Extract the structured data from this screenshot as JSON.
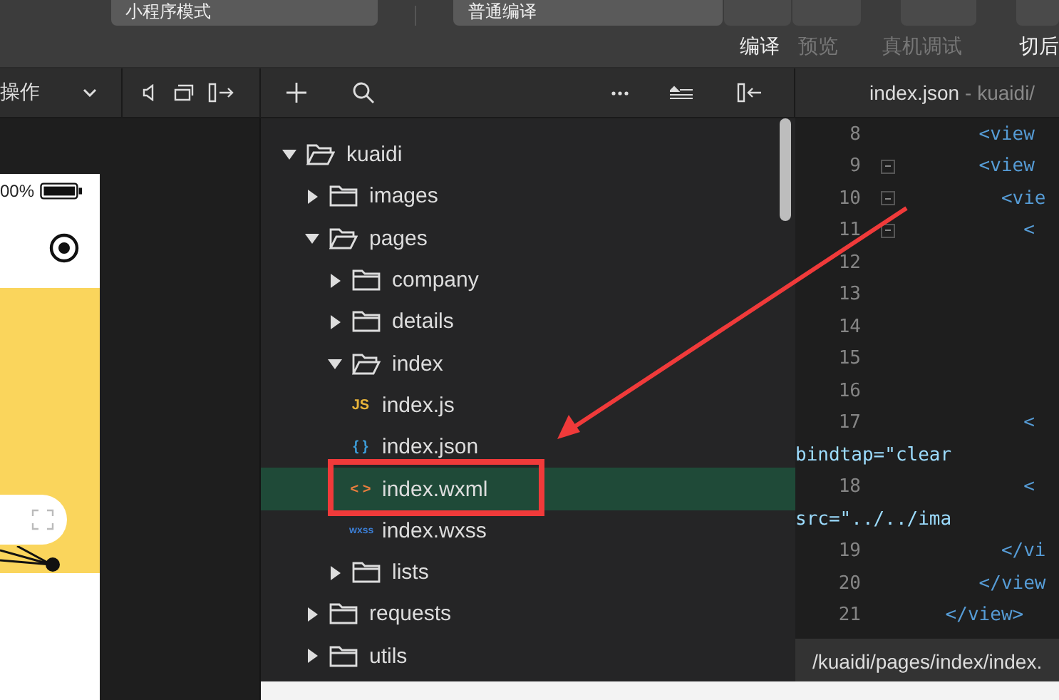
{
  "top_bar": {
    "mode_dropdown": "小程序模式",
    "compile_dropdown": "普通编译",
    "actions": [
      {
        "label": "编译",
        "disabled": false
      },
      {
        "label": "预览",
        "disabled": true
      },
      {
        "label": "真机调试",
        "disabled": true
      },
      {
        "label": "切后",
        "disabled": false
      }
    ]
  },
  "simulator": {
    "toolbar_label": "操作",
    "battery_text": "00%"
  },
  "file_tree": [
    {
      "name": "kuaidi",
      "kind": "folder",
      "expanded": true,
      "selected": false,
      "children": [
        {
          "name": "images",
          "kind": "folder",
          "expanded": false,
          "selected": false
        },
        {
          "name": "pages",
          "kind": "folder",
          "expanded": true,
          "selected": false,
          "children": [
            {
              "name": "company",
              "kind": "folder",
              "expanded": false,
              "selected": false
            },
            {
              "name": "details",
              "kind": "folder",
              "expanded": false,
              "selected": false
            },
            {
              "name": "index",
              "kind": "folder",
              "expanded": true,
              "selected": false,
              "children": [
                {
                  "name": "index.js",
                  "kind": "js",
                  "icon_text": "JS",
                  "selected": false
                },
                {
                  "name": "index.json",
                  "kind": "json",
                  "icon_text": "{ }",
                  "selected": false
                },
                {
                  "name": "index.wxml",
                  "kind": "wxml",
                  "icon_text": "< >",
                  "selected": true
                },
                {
                  "name": "index.wxss",
                  "kind": "wxss",
                  "icon_text": "wxss",
                  "selected": false
                }
              ]
            },
            {
              "name": "lists",
              "kind": "folder",
              "expanded": false,
              "selected": false
            }
          ]
        },
        {
          "name": "requests",
          "kind": "folder",
          "expanded": false,
          "selected": false
        },
        {
          "name": "utils",
          "kind": "folder",
          "expanded": false,
          "selected": false
        }
      ]
    }
  ],
  "editor": {
    "tab_title": "index.json",
    "tab_path": "- kuaidi/",
    "lines": [
      {
        "number": "8",
        "text": "       <view",
        "kind": "tag",
        "foldable": false
      },
      {
        "number": "9",
        "text": "       <view",
        "kind": "tag",
        "foldable": true
      },
      {
        "number": "10",
        "text": "         <vie",
        "kind": "tag",
        "foldable": true
      },
      {
        "number": "11",
        "text": "           <",
        "kind": "tag",
        "foldable": true
      },
      {
        "number": "12",
        "kind": "tag",
        "foldable": false
      },
      {
        "number": "13",
        "kind": "tag",
        "foldable": false
      },
      {
        "number": "14",
        "kind": "tag",
        "foldable": false
      },
      {
        "number": "15",
        "kind": "tag",
        "foldable": false
      },
      {
        "number": "16",
        "kind": "tag",
        "foldable": false
      },
      {
        "number": "17",
        "text": "           <",
        "kind": "tag",
        "foldable": false
      },
      {
        "text": "bindtap=\"clear",
        "kind": "attr"
      },
      {
        "number": "18",
        "text": "           <",
        "kind": "tag",
        "foldable": false
      },
      {
        "text": "src=\"../../ima",
        "kind": "attr"
      },
      {
        "number": "19",
        "text": "         </vi",
        "kind": "tag",
        "foldable": false
      },
      {
        "number": "20",
        "text": "       </view",
        "kind": "tag",
        "foldable": false
      },
      {
        "number": "21",
        "text": "    </view>",
        "kind": "tag",
        "foldable": false
      }
    ],
    "status_path": "/kuaidi/pages/index/index."
  }
}
